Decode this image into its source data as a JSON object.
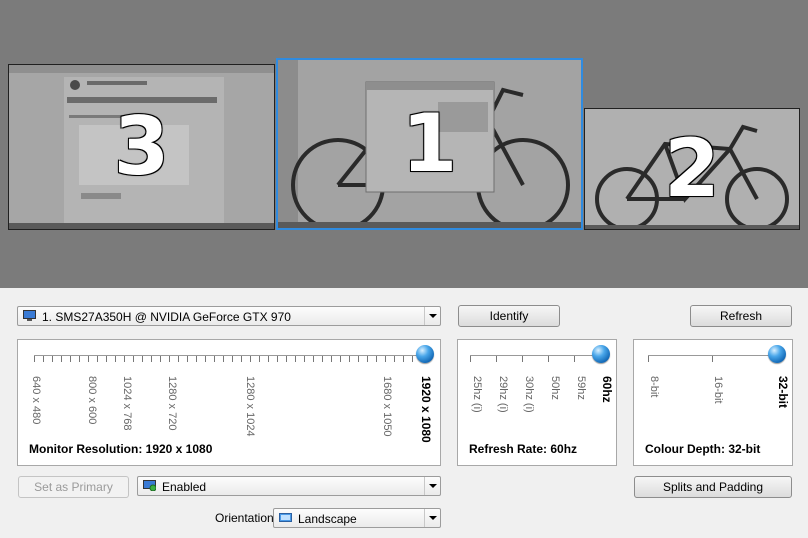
{
  "arrangement": {
    "monitors": [
      {
        "number": "3",
        "selected": false
      },
      {
        "number": "1",
        "selected": true
      },
      {
        "number": "2",
        "selected": false
      }
    ]
  },
  "display_select": {
    "value": "1. SMS27A350H @ NVIDIA GeForce GTX 970",
    "icon": "monitor-icon"
  },
  "buttons": {
    "identify": "Identify",
    "refresh": "Refresh",
    "set_primary": "Set as Primary",
    "splits": "Splits and Padding"
  },
  "resolution": {
    "caption": "Monitor Resolution: 1920 x 1080",
    "ticks": [
      "640 x 480",
      "800 x 600",
      "1024 x 768",
      "1280 x 720",
      "1280 x 1024",
      "1680 x 1050",
      "1920 x 1080"
    ],
    "selected_index": 6
  },
  "refresh_rate": {
    "caption": "Refresh Rate: 60hz",
    "ticks": [
      "25hz (i)",
      "29hz (i)",
      "30hz (i)",
      "50hz",
      "59hz",
      "60hz"
    ],
    "selected_index": 5
  },
  "colour_depth": {
    "caption": "Colour Depth: 32-bit",
    "ticks": [
      "8-bit",
      "16-bit",
      "32-bit"
    ],
    "selected_index": 2
  },
  "enabled_select": {
    "value": "Enabled",
    "icon": "monitor-enabled-icon"
  },
  "orientation": {
    "label": "Orientation:",
    "value": "Landscape",
    "icon": "landscape-icon"
  },
  "colors": {
    "accent": "#2f8be0",
    "arrangement_bg": "#7b7b7b"
  }
}
